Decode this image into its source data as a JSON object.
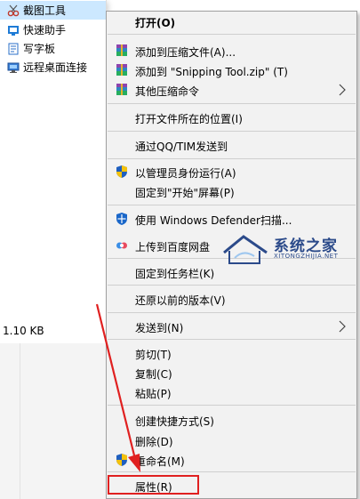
{
  "explorer": {
    "files": [
      {
        "name": "截图工具",
        "icon": "scissors-icon",
        "selected": true
      },
      {
        "name": "快速助手",
        "icon": "quick-assist-icon",
        "selected": false
      },
      {
        "name": "写字板",
        "icon": "wordpad-icon",
        "selected": false
      },
      {
        "name": "远程桌面连接",
        "icon": "remote-desktop-icon",
        "selected": false
      }
    ],
    "file_size": "1.10 KB"
  },
  "context_menu": {
    "items": [
      {
        "label": "打开(O)",
        "icon": null,
        "submenu": false
      },
      {
        "label": "添加到压缩文件(A)...",
        "icon": "archive-icon",
        "submenu": false
      },
      {
        "label": "添加到 \"Snipping Tool.zip\" (T)",
        "icon": "archive-icon",
        "submenu": false
      },
      {
        "label": "其他压缩命令",
        "icon": "archive-icon",
        "submenu": true
      },
      {
        "label": "打开文件所在的位置(I)",
        "icon": null,
        "submenu": false
      },
      {
        "label": "通过QQ/TIM发送到",
        "icon": null,
        "submenu": false
      },
      {
        "label": "以管理员身份运行(A)",
        "icon": "uac-shield-icon",
        "submenu": false
      },
      {
        "label": "固定到\"开始\"屏幕(P)",
        "icon": null,
        "submenu": false
      },
      {
        "label": "使用 Windows Defender扫描...",
        "icon": "defender-shield-icon",
        "submenu": false
      },
      {
        "label": "上传到百度网盘",
        "icon": "baidu-cloud-icon",
        "submenu": false
      },
      {
        "label": "固定到任务栏(K)",
        "icon": null,
        "submenu": false
      },
      {
        "label": "还原以前的版本(V)",
        "icon": null,
        "submenu": false
      },
      {
        "label": "发送到(N)",
        "icon": null,
        "submenu": true
      },
      {
        "label": "剪切(T)",
        "icon": null,
        "submenu": false
      },
      {
        "label": "复制(C)",
        "icon": null,
        "submenu": false
      },
      {
        "label": "粘贴(P)",
        "icon": null,
        "submenu": false
      },
      {
        "label": "创建快捷方式(S)",
        "icon": null,
        "submenu": false
      },
      {
        "label": "删除(D)",
        "icon": null,
        "submenu": false
      },
      {
        "label": "重命名(M)",
        "icon": "uac-shield-icon",
        "submenu": false
      },
      {
        "label": "属性(R)",
        "icon": null,
        "submenu": false
      }
    ]
  },
  "watermark": {
    "title": "系统之家",
    "subtitle": "XITONGZHIJIA.NET"
  },
  "colors": {
    "menu_bg": "#f2f2f2",
    "selection": "#cce8ff",
    "annotation_red": "#e02020",
    "watermark_blue": "#2b4a8a"
  }
}
